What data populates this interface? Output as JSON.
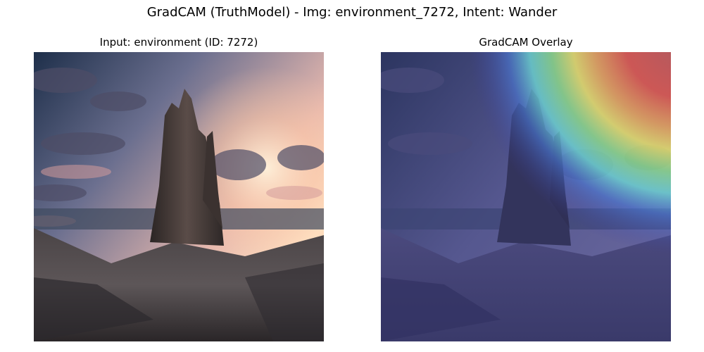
{
  "figure": {
    "title": "GradCAM (TruthModel) - Img: environment_7272, Intent: Wander"
  },
  "panels": [
    {
      "title": "Input: environment (ID: 7272)",
      "image": "mountain-landscape-photo"
    },
    {
      "title": "GradCAM Overlay",
      "image": "gradcam-heatmap-overlay"
    }
  ],
  "colors": {
    "sky_top": "#1e2f4a",
    "sunset_glow": "#ffd9b8",
    "rock_dark": "#3a3431",
    "overlay_tint": "#4a4a8c",
    "heat_red": "#d9574f",
    "heat_yellow": "#e8e06a",
    "heat_cyan": "#6fe0d8"
  }
}
